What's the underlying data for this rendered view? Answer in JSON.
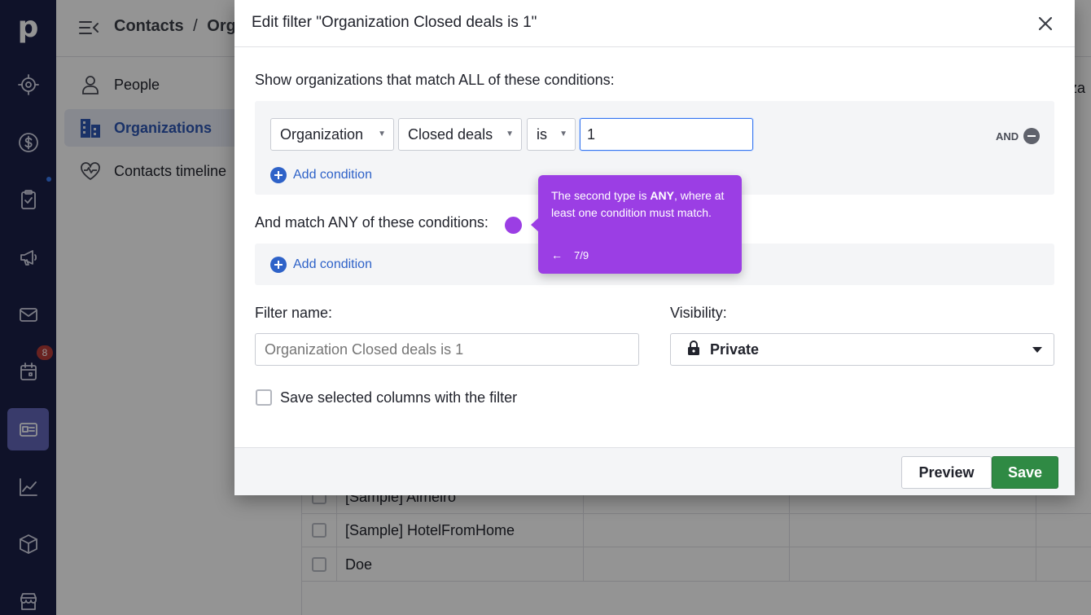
{
  "app": {
    "logo": "p",
    "nav_icons": [
      "target-icon",
      "dollar-icon",
      "clipboard-check-icon",
      "megaphone-icon",
      "mail-icon",
      "calendar-icon",
      "contacts-card-icon",
      "chart-line-icon",
      "box-icon",
      "store-icon"
    ],
    "calendar_badge": "8",
    "breadcrumb": {
      "root": "Contacts",
      "separator": "/",
      "current": "Org"
    },
    "subnav": [
      {
        "label": "People",
        "icon": "person-icon"
      },
      {
        "label": "Organizations",
        "icon": "building-icon",
        "active": true
      },
      {
        "label": "Contacts timeline",
        "icon": "heart-pulse-icon"
      }
    ],
    "side_label_fragment": "iza",
    "table_rows": [
      "[Sample] Almeiro",
      "[Sample] HotelFromHome",
      "Doe"
    ]
  },
  "modal": {
    "title": "Edit filter \"Organization Closed deals is 1\"",
    "all_label": "Show organizations that match ALL of these conditions:",
    "condition": {
      "entity": "Organization",
      "field": "Closed deals",
      "operator": "is",
      "value": "1",
      "and_label": "AND"
    },
    "add_condition_label": "Add condition",
    "any_label": "And match ANY of these conditions:",
    "filter_name_label": "Filter name:",
    "filter_name_placeholder": "Organization Closed deals is 1",
    "visibility_label": "Visibility:",
    "visibility_value": "Private",
    "save_columns_label": "Save selected columns with the filter",
    "preview_label": "Preview",
    "save_label": "Save"
  },
  "tooltip": {
    "text_before": "The second type is ",
    "text_bold": "ANY",
    "text_after": ", where at least one condition must match.",
    "back_arrow": "←",
    "step": "7/9"
  },
  "colors": {
    "nav_bg": "#1a1f47",
    "tooltip_bg": "#9b3ee4",
    "save_bg": "#2f8a44",
    "link_blue": "#2e62c8"
  }
}
